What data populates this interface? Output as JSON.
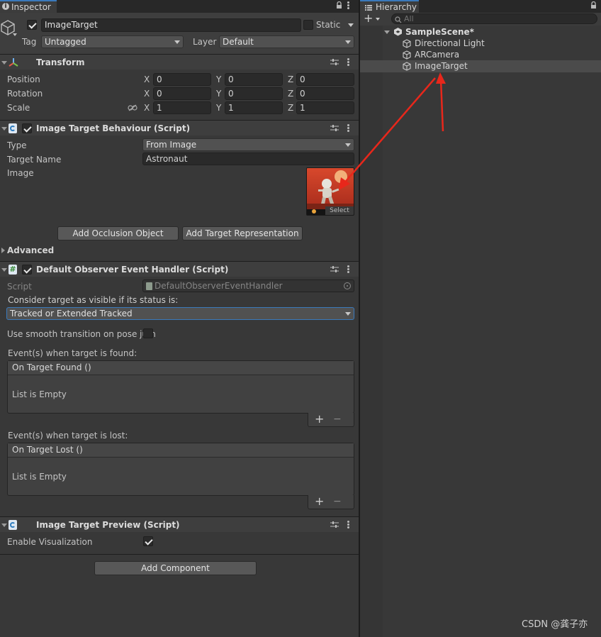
{
  "inspector": {
    "tab_label": "Inspector",
    "object": {
      "name": "ImageTarget",
      "static_label": "Static",
      "tag_label": "Tag",
      "tag_value": "Untagged",
      "layer_label": "Layer",
      "layer_value": "Default"
    },
    "transform": {
      "title": "Transform",
      "position": {
        "label": "Position",
        "x": "0",
        "y": "0",
        "z": "0"
      },
      "rotation": {
        "label": "Rotation",
        "x": "0",
        "y": "0",
        "z": "0"
      },
      "scale": {
        "label": "Scale",
        "x": "1",
        "y": "1",
        "z": "1"
      },
      "axis_x": "X",
      "axis_y": "Y",
      "axis_z": "Z"
    },
    "image_target_behaviour": {
      "title": "Image Target Behaviour (Script)",
      "type_label": "Type",
      "type_value": "From Image",
      "target_name_label": "Target Name",
      "target_name_value": "Astronaut",
      "image_label": "Image",
      "select_label": "Select",
      "add_occlusion": "Add Occlusion Object",
      "add_target_rep": "Add Target Representation"
    },
    "advanced_label": "Advanced",
    "observer": {
      "title": "Default Observer Event Handler (Script)",
      "script_label": "Script",
      "script_value": "DefaultObserverEventHandler",
      "consider_label": "Consider target as visible if its status is:",
      "status_value": "Tracked or Extended Tracked",
      "smooth_label": "Use smooth transition on pose jum",
      "found_label": "Event(s) when target is found:",
      "found_header": "On Target Found ()",
      "found_empty": "List is Empty",
      "lost_label": "Event(s) when target is lost:",
      "lost_header": "On Target Lost ()",
      "lost_empty": "List is Empty",
      "plus": "+",
      "minus": "−"
    },
    "preview": {
      "title": "Image Target Preview (Script)",
      "enable_label": "Enable Visualization"
    },
    "add_component": "Add Component"
  },
  "hierarchy": {
    "tab_label": "Hierarchy",
    "search_placeholder": "All",
    "scene": "SampleScene*",
    "items": [
      "Directional Light",
      "ARCamera",
      "ImageTarget"
    ]
  },
  "watermark": "CSDN @龚子亦",
  "colors": {
    "panel_bg": "#383838",
    "header_bg": "#3e3e3e",
    "selected_row": "#4a4a4a",
    "annotation_arrow": "#e8271b"
  },
  "icons": [
    "info-icon",
    "cube-icon",
    "transform-icon",
    "script-icon",
    "hash-script-icon",
    "settings-slider-icon",
    "kebab-icon",
    "lock-icon",
    "hierarchy-list-icon",
    "unity-scene-icon",
    "gameobject-icon",
    "search-icon",
    "link-icon",
    "target-icon"
  ]
}
